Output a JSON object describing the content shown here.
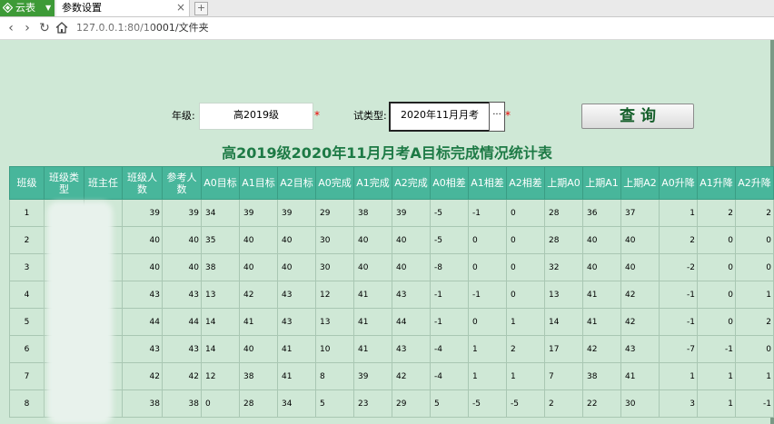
{
  "browser": {
    "app_name": "云表",
    "tab_title": "参数设置",
    "url": "127.0.0.1:80/10001/文件夹"
  },
  "form": {
    "grade_label": "年级:",
    "grade_value": "高2019级",
    "exam_label": "试类型:",
    "exam_value": "2020年11月月考",
    "ellipsis": "···",
    "required_mark": "*",
    "query_button": "查 询"
  },
  "report": {
    "title": "高2019级2020年11月月考A目标完成情况统计表",
    "headers": [
      "班级",
      "班级类型",
      "班主任",
      "班级人数",
      "参考人数",
      "A0目标",
      "A1目标",
      "A2目标",
      "A0完成",
      "A1完成",
      "A2完成",
      "A0相差",
      "A1相差",
      "A2相差",
      "上期A0",
      "上期A1",
      "上期A2",
      "A0升降",
      "A1升降",
      "A2升降"
    ],
    "rows": [
      [
        "1",
        "",
        "",
        "39",
        "39",
        "34",
        "39",
        "39",
        "29",
        "38",
        "39",
        "-5",
        "-1",
        "0",
        "28",
        "36",
        "37",
        "1",
        "2",
        "2"
      ],
      [
        "2",
        "",
        "",
        "40",
        "40",
        "35",
        "40",
        "40",
        "30",
        "40",
        "40",
        "-5",
        "0",
        "0",
        "28",
        "40",
        "40",
        "2",
        "0",
        "0"
      ],
      [
        "3",
        "",
        "",
        "40",
        "40",
        "38",
        "40",
        "40",
        "30",
        "40",
        "40",
        "-8",
        "0",
        "0",
        "32",
        "40",
        "40",
        "-2",
        "0",
        "0"
      ],
      [
        "4",
        "",
        "",
        "43",
        "43",
        "13",
        "42",
        "43",
        "12",
        "41",
        "43",
        "-1",
        "-1",
        "0",
        "13",
        "41",
        "42",
        "-1",
        "0",
        "1"
      ],
      [
        "5",
        "",
        "",
        "44",
        "44",
        "14",
        "41",
        "43",
        "13",
        "41",
        "44",
        "-1",
        "0",
        "1",
        "14",
        "41",
        "42",
        "-1",
        "0",
        "2"
      ],
      [
        "6",
        "",
        "",
        "43",
        "43",
        "14",
        "40",
        "41",
        "10",
        "41",
        "43",
        "-4",
        "1",
        "2",
        "17",
        "42",
        "43",
        "-7",
        "-1",
        "0"
      ],
      [
        "7",
        "",
        "",
        "42",
        "42",
        "12",
        "38",
        "41",
        "8",
        "39",
        "42",
        "-4",
        "1",
        "1",
        "7",
        "38",
        "41",
        "1",
        "1",
        "1"
      ],
      [
        "8",
        "",
        "",
        "38",
        "38",
        "0",
        "28",
        "34",
        "5",
        "23",
        "29",
        "5",
        "-5",
        "-5",
        "2",
        "22",
        "30",
        "3",
        "1",
        "-1"
      ]
    ]
  }
}
